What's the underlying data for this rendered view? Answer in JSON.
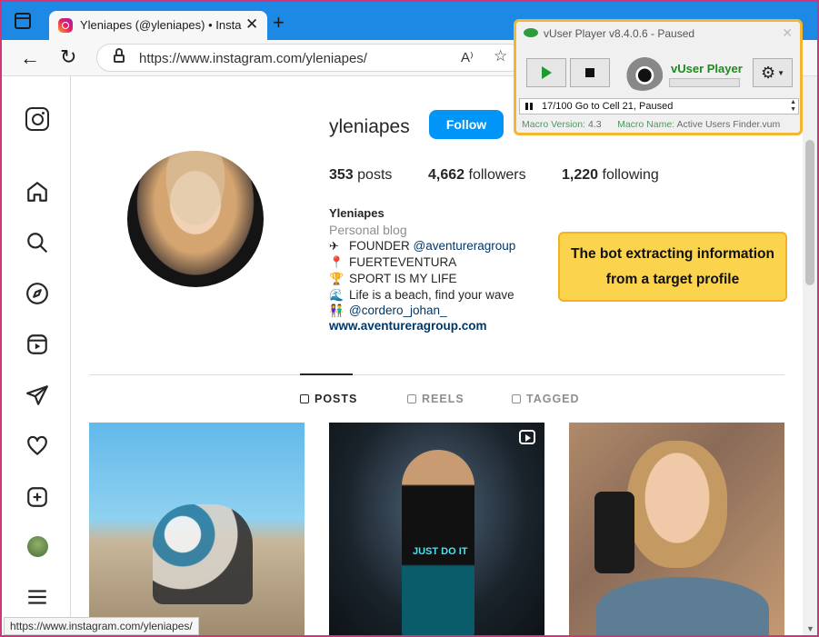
{
  "browser": {
    "tab_title": "Yleniapes (@yleniapes) • Instagram",
    "tab_close": "✕",
    "new_tab": "+",
    "url_prefix": "https://www.instagram.com/",
    "url_path": "yleniapes/",
    "read_aloud": "A⁾",
    "status_url": "https://www.instagram.com/yleniapes/"
  },
  "nav_icons": [
    "instagram-logo",
    "home",
    "search",
    "explore",
    "reels",
    "messages",
    "notifications",
    "create",
    "profile",
    "more"
  ],
  "profile": {
    "username": "yleniapes",
    "follow_label": "Follow",
    "posts_count": "353",
    "posts_label": "posts",
    "followers_count": "4,662",
    "followers_label": "followers",
    "following_count": "1,220",
    "following_label": "following",
    "name": "Yleniapes",
    "category": "Personal blog",
    "bio": [
      {
        "emoji": "✈",
        "text": "FOUNDER ",
        "mention": "@aventureragroup"
      },
      {
        "emoji": "📍",
        "text": "FUERTEVENTURA",
        "mention": ""
      },
      {
        "emoji": "🏆",
        "text": "SPORT IS MY LIFE",
        "mention": ""
      },
      {
        "emoji": "🌊",
        "text": "Life is a beach, find your wave",
        "mention": ""
      },
      {
        "emoji": "👫",
        "text": "",
        "mention": "@cordero_johan_"
      }
    ],
    "link": "www.aventureragroup.com"
  },
  "tabs": [
    {
      "label": "POSTS",
      "active": true
    },
    {
      "label": "REELS",
      "active": false
    },
    {
      "label": "TAGGED",
      "active": false
    }
  ],
  "posts": {
    "post2_overlay": "JUST DO IT"
  },
  "annotation": "The bot extracting information from a target profile",
  "vplayer": {
    "title": "vUser Player v8.4.0.6 - Paused",
    "brand": "vUser Player",
    "status": "17/100 Go to Cell 21, Paused",
    "macro_version_label": "Macro Version:",
    "macro_version": "4.3",
    "macro_name_label": "Macro Name:",
    "macro_name": "Active Users Finder.vum"
  },
  "colors": {
    "accent": "#0095f6",
    "frame": "#d0357a",
    "tabstrip": "#1e88e5",
    "annotation_bg": "#fcd34d",
    "vplayer_border": "#f2b632"
  }
}
